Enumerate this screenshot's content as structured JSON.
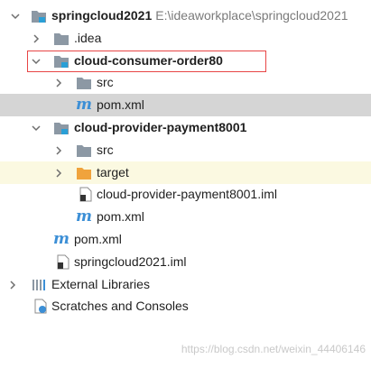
{
  "tree": [
    {
      "label": "springcloud2021",
      "path": "E:\\ideaworkplace\\springcloud2021"
    },
    {
      "label": ".idea"
    },
    {
      "label": "cloud-consumer-order80"
    },
    {
      "label": "src"
    },
    {
      "label": "pom.xml"
    },
    {
      "label": "cloud-provider-payment8001"
    },
    {
      "label": "src"
    },
    {
      "label": "target"
    },
    {
      "label": "cloud-provider-payment8001.iml"
    },
    {
      "label": "pom.xml"
    },
    {
      "label": "pom.xml"
    },
    {
      "label": "springcloud2021.iml"
    },
    {
      "label": "External Libraries"
    },
    {
      "label": "Scratches and Consoles"
    }
  ],
  "colors": {
    "folder": "#8c98a4",
    "module_badge": "#2a9fd6",
    "excluded_folder": "#f0a33c",
    "maven": "#3c8fd6",
    "highlight_border": "#e84545",
    "selected_bg": "#d5d5d5",
    "excluded_bg": "#fbf9e1"
  },
  "watermark": "https://blog.csdn.net/weixin_44406146"
}
